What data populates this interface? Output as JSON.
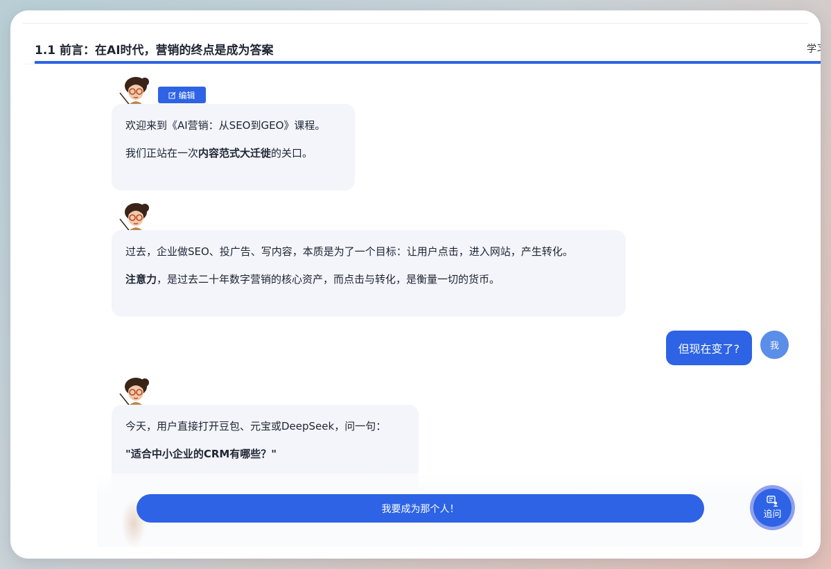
{
  "header": {
    "title": "1.1 前言：在AI时代，营销的终点是成为答案",
    "right_text": "学习"
  },
  "edit_button": {
    "label": "编辑",
    "icon": "edit-icon"
  },
  "messages": [
    {
      "role": "teacher",
      "paragraphs": [
        {
          "before": "欢迎来到《AI营销：从SEO到GEO》课程。",
          "bold": "",
          "after": ""
        },
        {
          "before": "我们正站在一次",
          "bold": "内容范式大迁徙",
          "after": "的关口。"
        }
      ]
    },
    {
      "role": "teacher",
      "paragraphs": [
        {
          "before": "过去，企业做SEO、投广告、写内容，本质是为了一个目标：让用户点击，进入网站，产生转化。",
          "bold": "",
          "after": ""
        },
        {
          "before": "",
          "bold": "注意力",
          "after": "，是过去二十年数字营销的核心资产，而点击与转化，是衡量一切的货币。"
        }
      ]
    },
    {
      "role": "user",
      "text": "但现在变了?",
      "avatar": "我"
    },
    {
      "role": "teacher",
      "paragraphs": [
        {
          "before": "今天，用户直接打开豆包、元宝或DeepSeek，问一句：",
          "bold": "",
          "after": ""
        },
        {
          "before": "",
          "bold": "\"适合中小企业的CRM有哪些？\"",
          "after": ""
        }
      ]
    }
  ],
  "primary_action": {
    "label": "我要成为那个人！"
  },
  "followup": {
    "label": "追问",
    "icon": "ask-icon"
  },
  "colors": {
    "accent": "#2d63e4",
    "bubble": "#f3f5fa",
    "text": "#1f2433"
  }
}
